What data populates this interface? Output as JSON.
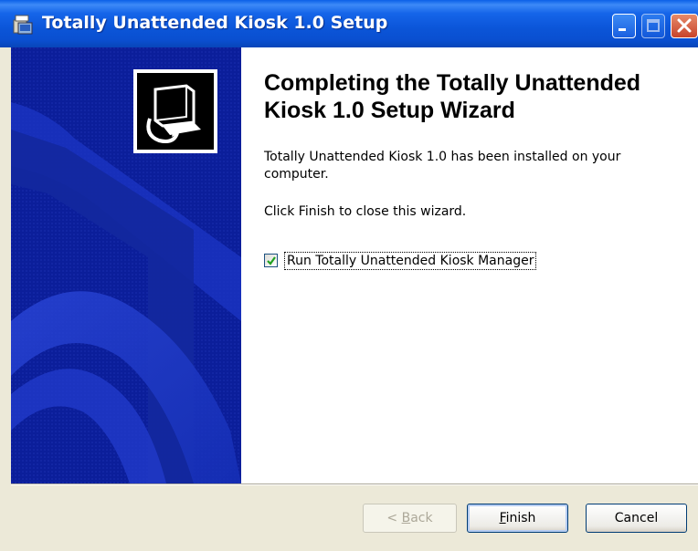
{
  "window": {
    "title": "Totally Unattended Kiosk 1.0 Setup",
    "accent": "#0a55d8"
  },
  "icons": {
    "app": "setup-app-icon",
    "minimize": "minimize-icon",
    "maximize": "maximize-icon",
    "close": "close-icon",
    "wizard_logo": "installer-computer-icon",
    "checkbox_mark": "checkmark-icon"
  },
  "wizard": {
    "heading": "Completing the Totally Unattended Kiosk 1.0 Setup Wizard",
    "description": "Totally Unattended Kiosk 1.0 has been installed on your computer.",
    "instruction": "Click Finish to close this wizard.",
    "run_checkbox": {
      "label": "Run Totally Unattended Kiosk Manager",
      "checked": true
    }
  },
  "buttons": {
    "back": {
      "prefix": "< ",
      "mnemonic": "B",
      "rest": "ack",
      "enabled": false
    },
    "finish": {
      "mnemonic": "F",
      "rest": "inish"
    },
    "cancel": {
      "label": "Cancel"
    }
  }
}
